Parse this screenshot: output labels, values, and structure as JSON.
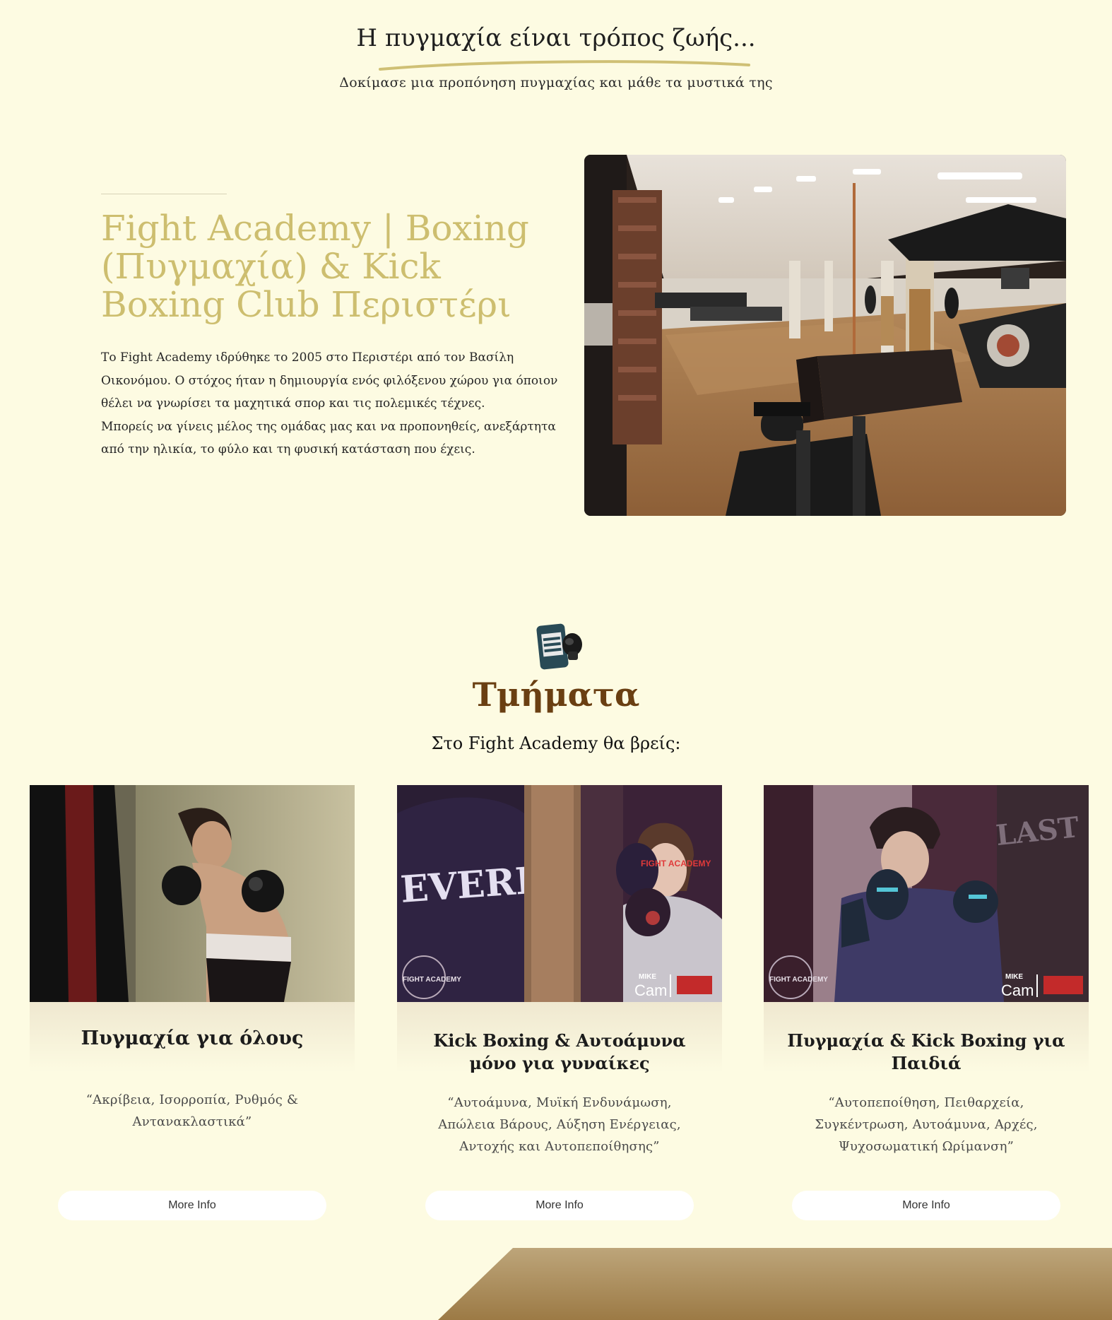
{
  "hero": {
    "title": "Η πυγμαχία είναι τρόπος ζωής...",
    "subtitle": "Δοκίμασε μια προπόνηση πυγμαχίας και μάθε τα μυστικά της"
  },
  "intro": {
    "heading": "Fight Academy | Boxing (Πυγμαχία) & Kick Boxing Club Περιστέρι",
    "paragraph1": "Το Fight Academy ιδρύθηκε το 2005 στο Περιστέρι από τον Βασίλη Οικονόμου. Ο στόχος ήταν η δημιουργία ενός φιλόξενου χώρου για όποιον θέλει να γνωρίσει τα μαχητικά σπορ και τις πολεμικές τέχνες.",
    "paragraph2": "Μπορείς να γίνεις μέλος της ομάδας μας και να προπονηθείς, ανεξάρτητα από την ηλικία, το φύλο και τη φυσική κατάσταση που έχεις."
  },
  "departments": {
    "title": "Τμήματα",
    "subtitle": "Στο Fight Academy θα βρείς:",
    "cards": [
      {
        "title": "Πυγμαχία για όλους",
        "description": "“Ακρίβεια, Ισορροπία, Ρυθμός & Αντανακλαστικά”",
        "button": "More Info"
      },
      {
        "title": "Kick Boxing & Αυτοάμυνα μόνο για γυναίκες",
        "description": "“Αυτοάμυνα, Μυϊκή Ενδυνάμωση, Απώλεια Βάρους, Αύξηση Ενέργειας, Αντοχής και Αυτοπεποίθησης”",
        "button": "More Info"
      },
      {
        "title": "Πυγμαχία & Kick Boxing για Παιδιά",
        "description": "“Αυτοπεποίθηση, Πειθαρχεία, Συγκέντρωση, Αυτοάμυνα, Αρχές, Ψυχοσωματική Ωρίμανση”",
        "button": "More Info"
      }
    ]
  },
  "photo_text": {
    "bag_brand": "EVERLAST",
    "gym_logo": "FIGHT ACADEMY",
    "bag_logo": "FIGHT ACADEMY",
    "photographer_line1": "MIKE",
    "photographer_line2": "Cam"
  },
  "colors": {
    "background": "#fdfbe2",
    "accent_gold": "#cdbe6f",
    "heading_brown": "#6a3f12",
    "footer_gradient_start": "#bda57a",
    "footer_gradient_end": "#9c7a45"
  }
}
